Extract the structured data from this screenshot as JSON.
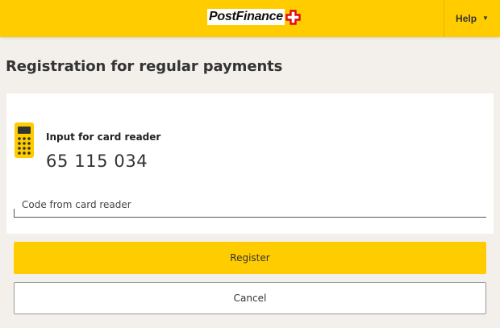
{
  "header": {
    "logo_text": "PostFinance",
    "help_label": "Help",
    "brand_yellow": "#ffcc00",
    "cross_red": "#e30613"
  },
  "page": {
    "title": "Registration for regular payments"
  },
  "card_reader": {
    "label": "Input for card reader",
    "code": "65 115 034",
    "icon": "card-reader-icon"
  },
  "form": {
    "code_placeholder": "Code from card reader",
    "code_value": ""
  },
  "actions": {
    "register_label": "Register",
    "cancel_label": "Cancel"
  }
}
